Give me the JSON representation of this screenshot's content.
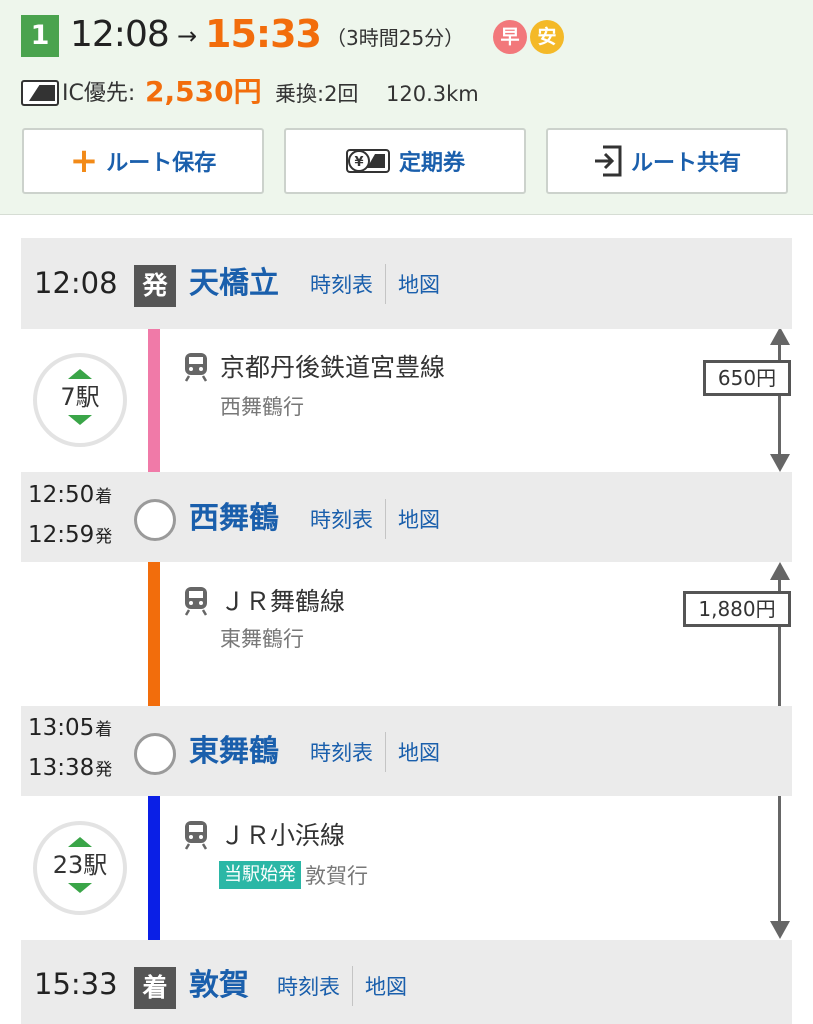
{
  "summary": {
    "route_number": "1",
    "departure_time": "12:08",
    "arrow": "→",
    "arrival_time": "15:33",
    "duration": "（3時間25分）",
    "badges": [
      {
        "label": "早",
        "meaning": "fast",
        "color": "#f2787b"
      },
      {
        "label": "安",
        "meaning": "cheap",
        "color": "#f4b928"
      }
    ],
    "ic_label": "IC優先:",
    "fare": "2,530円",
    "transfers": "乗換:2回",
    "distance": "120.3km",
    "buttons": {
      "save": "ルート保存",
      "commuter_pass": "定期券",
      "share": "ルート共有"
    }
  },
  "route": {
    "stations": [
      {
        "name": "天橋立",
        "time": "12:08",
        "mark": "発",
        "timetable": "時刻表",
        "map": "地図"
      },
      {
        "name": "西舞鶴",
        "arrive": "12:50",
        "depart": "12:59",
        "arrive_suffix": "着",
        "depart_suffix": "発",
        "timetable": "時刻表",
        "map": "地図"
      },
      {
        "name": "東舞鶴",
        "arrive": "13:05",
        "depart": "13:38",
        "arrive_suffix": "着",
        "depart_suffix": "発",
        "timetable": "時刻表",
        "map": "地図"
      },
      {
        "name": "敦賀",
        "time": "15:33",
        "mark": "着",
        "timetable": "時刻表",
        "map": "地図"
      }
    ],
    "segments": [
      {
        "line": "京都丹後鉄道宮豊線",
        "bound": "西舞鶴行",
        "stops": "7駅",
        "color": "#f07aa8"
      },
      {
        "line": "ＪＲ舞鶴線",
        "bound": "東舞鶴行",
        "color": "#f26d0c"
      },
      {
        "line": "ＪＲ小浜線",
        "start_tag": "当駅始発",
        "bound": "敦賀行",
        "stops": "23駅",
        "color": "#0a1fe6"
      }
    ],
    "fares": [
      "650円",
      "1,880円"
    ]
  },
  "colors": {
    "accent_orange": "#f26d0c",
    "link_blue": "#1a5fac",
    "route_badge_green": "#4aa34e",
    "header_bg": "#eef6ec"
  }
}
